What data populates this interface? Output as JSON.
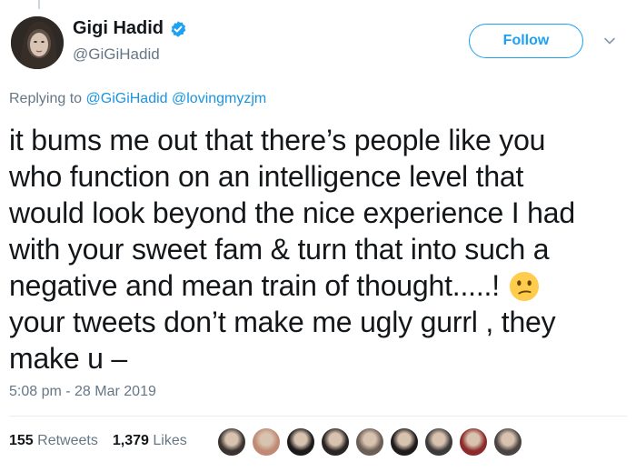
{
  "user": {
    "name": "Gigi Hadid",
    "handle": "@GiGiHadid"
  },
  "header": {
    "follow_label": "Follow"
  },
  "reply": {
    "prefix": "Replying to",
    "mentions": [
      "@GiGiHadid",
      "@lovingmyzjm"
    ]
  },
  "tweet": {
    "lines": [
      "it bums me out that there’s people like you",
      "who function on an intelligence level that",
      "would look beyond the nice experience I had",
      "with your sweet fam & turn that into such a",
      "negative and mean train of thought.....!",
      "your tweets don’t make me ugly gurrl , they",
      "make u –"
    ],
    "emoji": "confused-face-emoji",
    "timestamp": "5:08 pm - 28 Mar 2019"
  },
  "stats": {
    "retweets_count": "155",
    "retweets_label": "Retweets",
    "likes_count": "1,379",
    "likes_label": "Likes"
  },
  "likers": [
    {
      "color": "#3a3330"
    },
    {
      "color": "#c08a74"
    },
    {
      "color": "#1c1a1a"
    },
    {
      "color": "#2a2424"
    },
    {
      "color": "#6b5e55"
    },
    {
      "color": "#1e1b1a"
    },
    {
      "color": "#3c3a3a"
    },
    {
      "color": "#8c2b2b"
    },
    {
      "color": "#4a4442"
    }
  ],
  "colors": {
    "accent": "#1da1f2",
    "secondary_text": "#657786",
    "primary_text": "#14171a"
  }
}
